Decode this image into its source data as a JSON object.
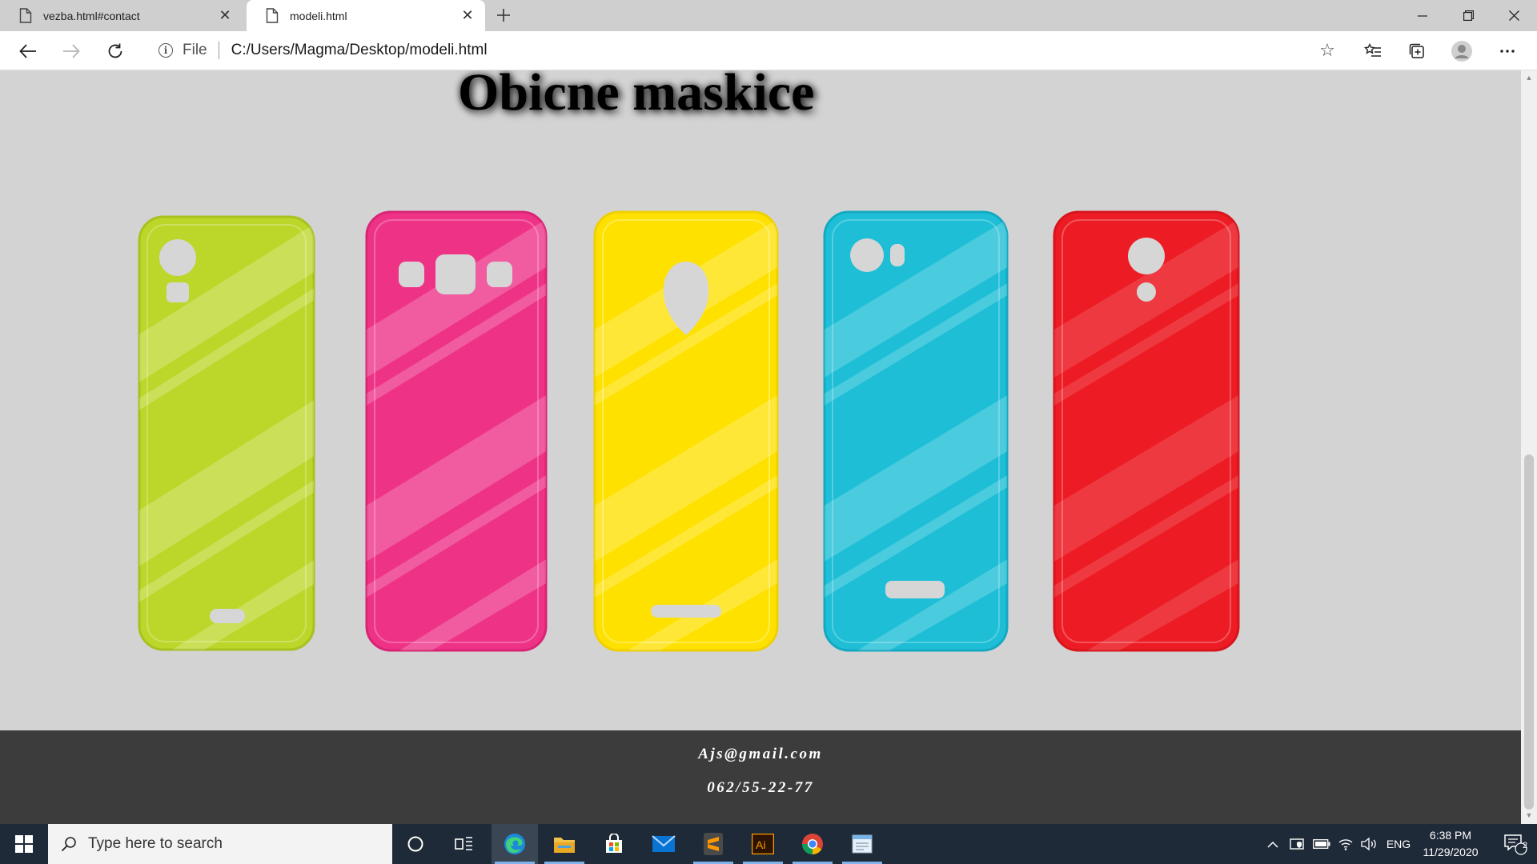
{
  "browser": {
    "tabs": [
      {
        "label": "vezba.html#contact",
        "active": false
      },
      {
        "label": "modeli.html",
        "active": true
      }
    ],
    "address": {
      "scheme_label": "File",
      "url": "C:/Users/Magma/Desktop/modeli.html"
    }
  },
  "page": {
    "title": "Obicne maskice",
    "cases": [
      {
        "color": "#bdd62a",
        "camera": "vertical-circle-square"
      },
      {
        "color": "#ee3387",
        "camera": "three-squares"
      },
      {
        "color": "#ffe100",
        "camera": "teardrop"
      },
      {
        "color": "#1dbed6",
        "camera": "circle-pill"
      },
      {
        "color": "#ed1c24",
        "camera": "circle-small-circle"
      }
    ],
    "footer": {
      "email": "Ajs@gmail.com",
      "phone": "062/55-22-77"
    }
  },
  "taskbar": {
    "search_placeholder": "Type here to search",
    "apps": [
      "cortana-icon",
      "task-view-icon",
      "edge-icon",
      "file-explorer-icon",
      "store-icon",
      "mail-icon",
      "sublime-text-icon",
      "illustrator-icon",
      "chrome-icon",
      "notepad-icon"
    ],
    "language": "ENG",
    "time": "6:38 PM",
    "date": "11/29/2020",
    "notification_count": "2"
  },
  "colors": {
    "page_background": "#d3d3d3",
    "footer_background": "#3c3c3c",
    "taskbar_background": "#1f2a38"
  }
}
